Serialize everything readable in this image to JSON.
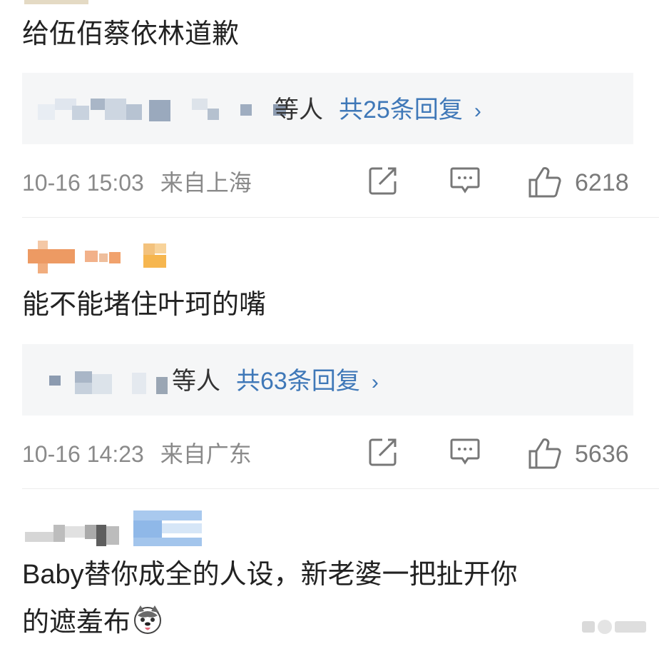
{
  "comments": [
    {
      "text": "给伍佰蔡依林道歉",
      "reply_people": "等人",
      "reply_count": "共25条回复",
      "reply_chevron": "›",
      "time": "10-16 15:03",
      "location": "来自上海",
      "likes": "6218"
    },
    {
      "text": "能不能堵住叶珂的嘴",
      "reply_people": "等人",
      "reply_count": "共63条回复",
      "reply_chevron": "›",
      "time": "10-16 14:23",
      "location": "来自广东",
      "likes": "5636"
    },
    {
      "text_line1": "Baby替你成全的人设，新老婆一把扯开你",
      "text_line2": "的遮羞布"
    }
  ],
  "colors": {
    "link": "#3f78b8",
    "meta": "#8a8a8a",
    "reply_bg": "#f5f6f7"
  }
}
